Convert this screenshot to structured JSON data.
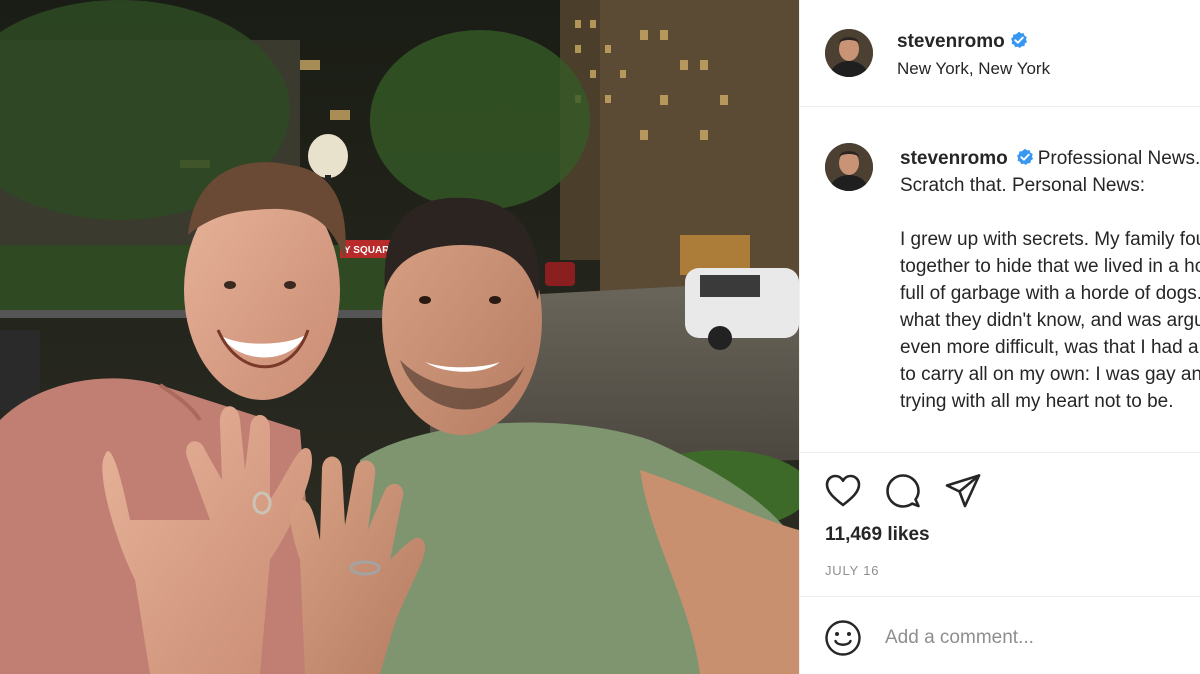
{
  "post": {
    "author": {
      "username": "stevenromo",
      "verified": true,
      "location": "New York, New York",
      "avatar_icon": "profile-photo"
    },
    "photo": {
      "sign_text": "Y SQUAR",
      "description_icon": "selfie-photo"
    },
    "caption": {
      "lines_intro": "Professional News. Scratch that. Personal News:",
      "paragraph": "I grew up with secrets. My family fought together to hide that we lived in a house full of garbage with a horde of dogs. But what they didn't know, and was arguably even more difficult, was that I had a secret to carry all on my own: I was gay and trying with all my heart not to be."
    },
    "actions": {
      "like_icon": "heart-icon",
      "comment_icon": "comment-icon",
      "share_icon": "share-icon"
    },
    "likes": "11,469 likes",
    "date": "JULY 16",
    "comment_box": {
      "placeholder": "Add a comment...",
      "emoji_icon": "emoji-icon"
    }
  },
  "colors": {
    "verified_blue": "#3897f0",
    "text": "#262626",
    "muted": "#8e8e8e",
    "border": "#efefef"
  }
}
